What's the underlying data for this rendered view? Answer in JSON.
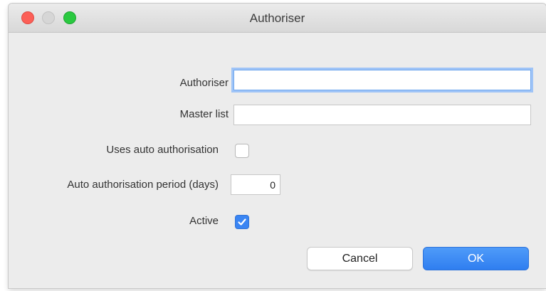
{
  "window": {
    "title": "Authoriser"
  },
  "form": {
    "authoriser": {
      "label": "Authoriser",
      "value": ""
    },
    "master_list": {
      "label": "Master list",
      "value": ""
    },
    "uses_auto_authorisation": {
      "label": "Uses auto authorisation",
      "checked": false
    },
    "auto_authorisation_period": {
      "label": "Auto authorisation period (days)",
      "value": "0"
    },
    "active": {
      "label": "Active",
      "checked": true
    }
  },
  "buttons": {
    "cancel_label": "Cancel",
    "ok_label": "OK"
  },
  "colors": {
    "accent": "#3a85f3",
    "close": "#fc5f57",
    "zoom": "#2ac940"
  },
  "icons": {
    "check": "checkmark-icon"
  }
}
